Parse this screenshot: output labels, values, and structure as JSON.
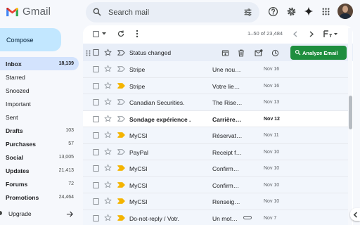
{
  "app": {
    "name": "Gmail"
  },
  "search": {
    "placeholder": "Search mail"
  },
  "compose": {
    "label": "Compose"
  },
  "nav": [
    {
      "label": "Inbox",
      "count": "18,139",
      "active": true,
      "bold": true
    },
    {
      "label": "Starred",
      "count": "",
      "active": false,
      "bold": false
    },
    {
      "label": "Snoozed",
      "count": "",
      "active": false,
      "bold": false
    },
    {
      "label": "Important",
      "count": "",
      "active": false,
      "bold": false
    },
    {
      "label": "Sent",
      "count": "",
      "active": false,
      "bold": false
    },
    {
      "label": "Drafts",
      "count": "103",
      "active": false,
      "bold": true
    },
    {
      "label": "Purchases",
      "count": "57",
      "active": false,
      "bold": true
    },
    {
      "label": "Social",
      "count": "13,005",
      "active": false,
      "bold": true
    },
    {
      "label": "Updates",
      "count": "21,413",
      "active": false,
      "bold": true
    },
    {
      "label": "Forums",
      "count": "72",
      "active": false,
      "bold": true
    },
    {
      "label": "Promotions",
      "count": "24,464",
      "active": false,
      "bold": true
    }
  ],
  "upgrade": {
    "label": "Upgrade"
  },
  "toolbar": {
    "pager": "1–50 of 23,484"
  },
  "selection_bar": {
    "label": "Status changed",
    "analyze_label": "Analyze Email"
  },
  "emails": [
    {
      "sender": "Stripe",
      "subject": "Une nou…",
      "date": "Nov 16",
      "unread": false,
      "important": false,
      "attachment": false
    },
    {
      "sender": "Stripe",
      "subject": "Votre lie…",
      "date": "Nov 16",
      "unread": false,
      "important": true,
      "attachment": false
    },
    {
      "sender": "Canadian Securities.",
      "subject": "The Rise…",
      "date": "Nov 13",
      "unread": false,
      "important": false,
      "attachment": false
    },
    {
      "sender": "Sondage expérience .",
      "subject": "Carrière…",
      "date": "Nov 12",
      "unread": true,
      "important": false,
      "attachment": false
    },
    {
      "sender": "MyCSI",
      "subject": "Réservat…",
      "date": "Nov 11",
      "unread": false,
      "important": true,
      "attachment": false
    },
    {
      "sender": "PayPal",
      "subject": "Receipt f…",
      "date": "Nov 10",
      "unread": false,
      "important": false,
      "attachment": false
    },
    {
      "sender": "MyCSI",
      "subject": "Confirm…",
      "date": "Nov 10",
      "unread": false,
      "important": true,
      "attachment": false
    },
    {
      "sender": "MyCSI",
      "subject": "Confirm…",
      "date": "Nov 10",
      "unread": false,
      "important": true,
      "attachment": false
    },
    {
      "sender": "MyCSI",
      "subject": "Renseig…",
      "date": "Nov 10",
      "unread": false,
      "important": true,
      "attachment": false
    },
    {
      "sender": "Do-not-reply / Votr.",
      "subject": "Un mot…",
      "date": "Nov 7",
      "unread": false,
      "important": true,
      "attachment": true
    }
  ],
  "colors": {
    "accent": "#0b57d0",
    "compose_bg": "#c2e7ff",
    "active_nav": "#d3e3fd",
    "analyze_bg": "#1e8e3e",
    "important": "#f4b400"
  }
}
